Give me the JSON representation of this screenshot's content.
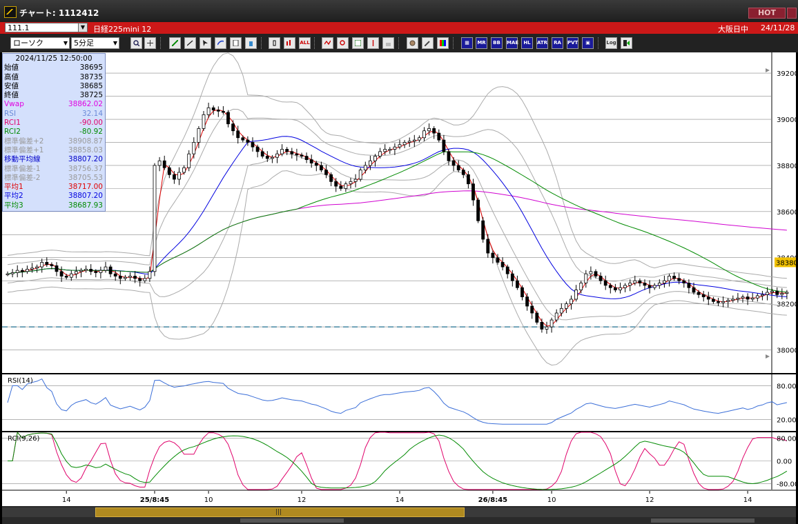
{
  "window": {
    "title": "チャート: 1112412",
    "hot_label": "HOT"
  },
  "symbol_bar": {
    "code": "111.1",
    "name": "日経225mini 12",
    "market": "大阪日中",
    "date": "24/11/28"
  },
  "toolbar": {
    "chart_type": "ローソク",
    "interval": "5分足",
    "button_labels": [
      "ALL",
      "MR",
      "BB",
      "MAE",
      "HL",
      "ATR",
      "RA",
      "PVT",
      "Log"
    ]
  },
  "info": {
    "timestamp": "2024/11/25  12:50:00",
    "rows": [
      {
        "label": "始値",
        "value": "38695",
        "color": "#000000"
      },
      {
        "label": "高値",
        "value": "38735",
        "color": "#000000"
      },
      {
        "label": "安値",
        "value": "38685",
        "color": "#000000"
      },
      {
        "label": "終値",
        "value": "38725",
        "color": "#000000"
      },
      {
        "label": "Vwap",
        "value": "38862.02",
        "color": "#e000e0"
      },
      {
        "label": "RSI",
        "value": "32.14",
        "color": "#6a8ad8"
      },
      {
        "label": "RCI1",
        "value": "-90.00",
        "color": "#e0006a"
      },
      {
        "label": "RCI2",
        "value": "-80.92",
        "color": "#008a00"
      },
      {
        "label": "標準偏差+2",
        "value": "38908.87",
        "color": "#999999"
      },
      {
        "label": "標準偏差+1",
        "value": "38858.03",
        "color": "#999999"
      },
      {
        "label": "移動平均線",
        "value": "38807.20",
        "color": "#0000c8"
      },
      {
        "label": "標準偏差-1",
        "value": "38756.37",
        "color": "#999999"
      },
      {
        "label": "標準偏差-2",
        "value": "38705.53",
        "color": "#999999"
      },
      {
        "label": "平均1",
        "value": "38717.00",
        "color": "#e00000"
      },
      {
        "label": "平均2",
        "value": "38807.20",
        "color": "#0000e0"
      },
      {
        "label": "平均3",
        "value": "38687.93",
        "color": "#008a00"
      }
    ]
  },
  "chart_data": [
    {
      "type": "candlestick",
      "title": "",
      "yticks": [
        38000,
        38200,
        38400,
        38600,
        38800,
        39000,
        39200
      ],
      "ylim": [
        37900,
        39290
      ],
      "current_price": "38380",
      "dashed_level": 38100,
      "x_ticks": [
        {
          "label": "14",
          "t": 12
        },
        {
          "label": "25/8:45",
          "t": 30
        },
        {
          "label": "10",
          "t": 41
        },
        {
          "label": "12",
          "t": 60
        },
        {
          "label": "14",
          "t": 80
        },
        {
          "label": "26/8:45",
          "t": 99
        },
        {
          "label": "10",
          "t": 111
        },
        {
          "label": "12",
          "t": 131
        },
        {
          "label": "14",
          "t": 151
        }
      ],
      "closes": [
        38330,
        38335,
        38345,
        38340,
        38350,
        38355,
        38360,
        38380,
        38370,
        38365,
        38340,
        38320,
        38315,
        38330,
        38340,
        38345,
        38350,
        38340,
        38335,
        38345,
        38360,
        38330,
        38320,
        38310,
        38315,
        38320,
        38310,
        38300,
        38310,
        38340,
        38800,
        38820,
        38790,
        38760,
        38740,
        38770,
        38790,
        38850,
        38900,
        38960,
        39020,
        39050,
        39040,
        39035,
        39030,
        38980,
        38950,
        38920,
        38910,
        38900,
        38880,
        38860,
        38840,
        38830,
        38835,
        38850,
        38870,
        38860,
        38850,
        38845,
        38840,
        38825,
        38810,
        38800,
        38780,
        38760,
        38730,
        38710,
        38700,
        38720,
        38730,
        38740,
        38780,
        38800,
        38820,
        38840,
        38860,
        38870,
        38870,
        38880,
        38890,
        38900,
        38905,
        38910,
        38920,
        38950,
        38960,
        38940,
        38910,
        38860,
        38820,
        38800,
        38780,
        38760,
        38720,
        38650,
        38560,
        38480,
        38420,
        38400,
        38380,
        38360,
        38330,
        38300,
        38270,
        38230,
        38190,
        38160,
        38120,
        38090,
        38100,
        38130,
        38160,
        38180,
        38200,
        38220,
        38260,
        38290,
        38330,
        38340,
        38320,
        38300,
        38280,
        38270,
        38260,
        38270,
        38280,
        38290,
        38300,
        38290,
        38280,
        38270,
        38280,
        38290,
        38300,
        38320,
        38310,
        38300,
        38290,
        38270,
        38250,
        38240,
        38230,
        38220,
        38210,
        38205,
        38210,
        38215,
        38220,
        38225,
        38230,
        38220,
        38225,
        38235,
        38240,
        38250,
        38255,
        38240,
        38245,
        38250
      ],
      "vwap": 38862.02,
      "series": [
        {
          "name": "平均1",
          "color": "#e00000",
          "period": 3
        },
        {
          "name": "平均2",
          "color": "#0000e0",
          "period": 20
        },
        {
          "name": "平均3",
          "color": "#008a00",
          "period": 60
        }
      ]
    },
    {
      "type": "line",
      "title": "RSI(14)",
      "yticks": [
        "80.00",
        "20.00"
      ],
      "ylim": [
        0,
        100
      ],
      "series": [
        {
          "name": "RSI",
          "color": "#3a6ed8",
          "period": 14
        }
      ]
    },
    {
      "type": "line",
      "title": "RCI(9,26)",
      "yticks": [
        "80.00",
        "0.00",
        "-80.00"
      ],
      "ylim": [
        -100,
        100
      ],
      "series": [
        {
          "name": "RCI1",
          "color": "#e0006a",
          "period": 9
        },
        {
          "name": "RCI2",
          "color": "#008a00",
          "period": 26
        }
      ]
    }
  ]
}
